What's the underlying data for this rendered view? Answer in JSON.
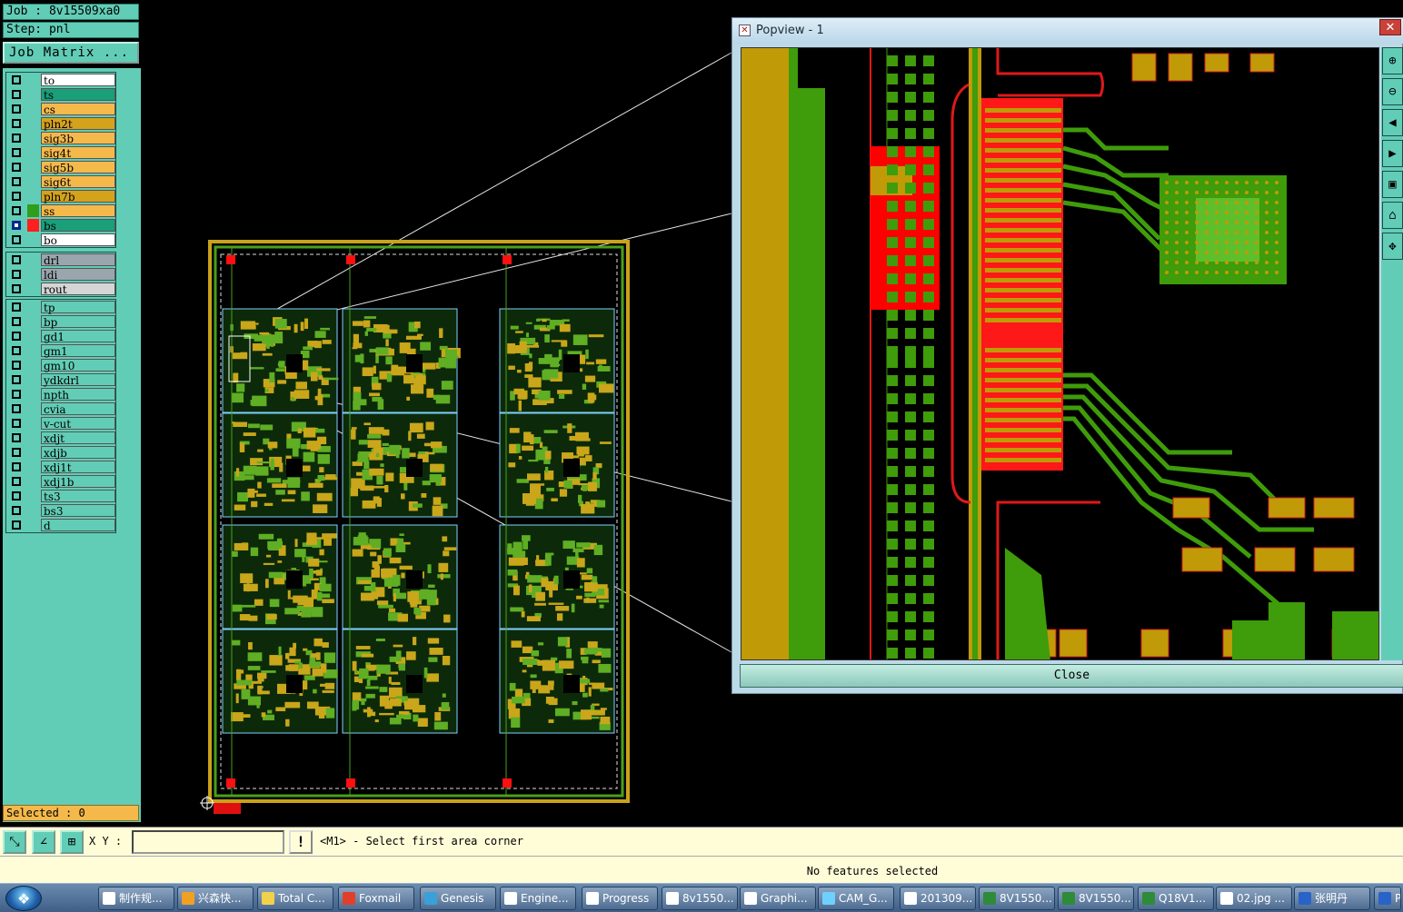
{
  "job": {
    "label": "Job : 8v15509xa0",
    "step": "Step: pnl"
  },
  "job_matrix_label": "Job Matrix ...",
  "layers_group1": [
    {
      "name": "to",
      "color": "#ffffff",
      "swatch": "",
      "affected": false
    },
    {
      "name": "ts",
      "color": "#1a9f7a",
      "swatch": "",
      "affected": false
    },
    {
      "name": "cs",
      "color": "#f5b94b",
      "swatch": "",
      "affected": false
    },
    {
      "name": "pln2t",
      "color": "#d5a21c",
      "swatch": "",
      "affected": false
    },
    {
      "name": "sig3b",
      "color": "#f5b94b",
      "swatch": "",
      "affected": false
    },
    {
      "name": "sig4t",
      "color": "#f5b94b",
      "swatch": "",
      "affected": false
    },
    {
      "name": "sig5b",
      "color": "#f5b94b",
      "swatch": "",
      "affected": false
    },
    {
      "name": "sig6t",
      "color": "#f5b94b",
      "swatch": "",
      "affected": false
    },
    {
      "name": "pln7b",
      "color": "#d5a21c",
      "swatch": "",
      "affected": false
    },
    {
      "name": "ss",
      "color": "#f5b94b",
      "swatch": "#2f9e1c",
      "affected": false
    },
    {
      "name": "bs",
      "color": "#1a9f7a",
      "swatch": "#ff1f1f",
      "affected": true
    },
    {
      "name": "bo",
      "color": "#ffffff",
      "swatch": "",
      "affected": false
    }
  ],
  "layers_group2": [
    {
      "name": "drl",
      "color": "#9aa6ae"
    },
    {
      "name": "ldi",
      "color": "#9aa6ae"
    },
    {
      "name": "rout",
      "color": "#d5d5d5"
    }
  ],
  "layers_group3": [
    {
      "name": "tp"
    },
    {
      "name": "bp"
    },
    {
      "name": "gd1"
    },
    {
      "name": "gm1"
    },
    {
      "name": "gm10"
    },
    {
      "name": "ydkdrl"
    },
    {
      "name": "npth"
    },
    {
      "name": "cvia"
    },
    {
      "name": "v-cut"
    },
    {
      "name": "xdjt"
    },
    {
      "name": "xdjb"
    },
    {
      "name": "xdj1t"
    },
    {
      "name": "xdj1b"
    },
    {
      "name": "ts3"
    },
    {
      "name": "bs3"
    },
    {
      "name": "d"
    }
  ],
  "selected_label": "Selected : 0",
  "popview": {
    "title": "Popview - 1",
    "close_label": "Close",
    "close_x": "✕"
  },
  "cmd": {
    "xy_label": "X Y :",
    "xy_value": "",
    "prompt": "<M1> - Select first area corner",
    "warn": "!"
  },
  "status": "No features selected",
  "taskbar": [
    {
      "label": "制作规...",
      "icon_color": "#ffffff"
    },
    {
      "label": "兴森快...",
      "icon_color": "#f2a024"
    },
    {
      "label": "Total C...",
      "icon_color": "#f0d24a"
    },
    {
      "label": "Foxmail",
      "icon_color": "#e0402a"
    },
    {
      "label": "Genesis",
      "icon_color": "#3aa0d8"
    },
    {
      "label": "Engine...",
      "icon_color": "#ffffff"
    },
    {
      "label": "Progress",
      "icon_color": "#ffffff"
    },
    {
      "label": "8v1550...",
      "icon_color": "#ffffff"
    },
    {
      "label": "Graphi...",
      "icon_color": "#ffffff"
    },
    {
      "label": "CAM_G...",
      "icon_color": "#6fd0ff"
    },
    {
      "label": "201309...",
      "icon_color": "#ffffff"
    },
    {
      "label": "8V1550...",
      "icon_color": "#2e8b3a"
    },
    {
      "label": "8V1550...",
      "icon_color": "#2e8b3a"
    },
    {
      "label": "Q18V1...",
      "icon_color": "#2e8b3a"
    },
    {
      "label": "02.jpg ...",
      "icon_color": "#ffffff"
    },
    {
      "label": "张明丹",
      "icon_color": "#2a63c8"
    },
    {
      "label": "P",
      "icon_color": "#2a63c8"
    }
  ]
}
